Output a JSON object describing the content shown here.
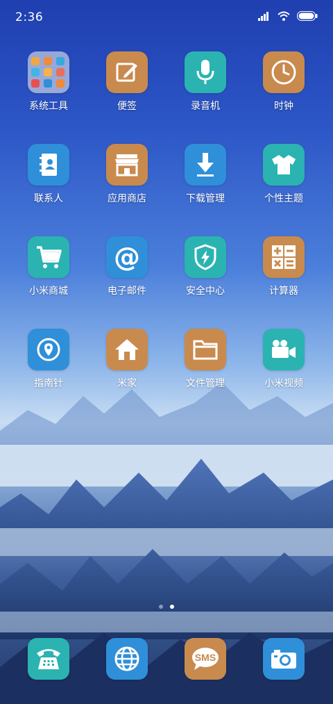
{
  "status": {
    "time": "2:36"
  },
  "apps": [
    {
      "label": "系统工具",
      "icon": "folder-icon"
    },
    {
      "label": "便签",
      "icon": "notes-edit-icon"
    },
    {
      "label": "录音机",
      "icon": "microphone-icon"
    },
    {
      "label": "时钟",
      "icon": "clock-icon"
    },
    {
      "label": "联系人",
      "icon": "contacts-book-icon"
    },
    {
      "label": "应用商店",
      "icon": "store-icon"
    },
    {
      "label": "下载管理",
      "icon": "download-arrow-icon"
    },
    {
      "label": "个性主题",
      "icon": "tshirt-icon"
    },
    {
      "label": "小米商城",
      "icon": "shopping-cart-icon"
    },
    {
      "label": "电子邮件",
      "icon": "at-sign-icon"
    },
    {
      "label": "安全中心",
      "icon": "shield-bolt-icon"
    },
    {
      "label": "计算器",
      "icon": "calculator-icon"
    },
    {
      "label": "指南针",
      "icon": "compass-pin-icon"
    },
    {
      "label": "米家",
      "icon": "home-icon"
    },
    {
      "label": "文件管理",
      "icon": "file-folder-icon"
    },
    {
      "label": "小米视频",
      "icon": "video-camera-icon"
    }
  ],
  "dock": [
    {
      "icon": "telephone-icon"
    },
    {
      "icon": "globe-icon"
    },
    {
      "icon": "sms-icon",
      "text": "SMS"
    },
    {
      "icon": "camera-icon"
    }
  ],
  "pager": {
    "pages": 2,
    "current": 2
  }
}
